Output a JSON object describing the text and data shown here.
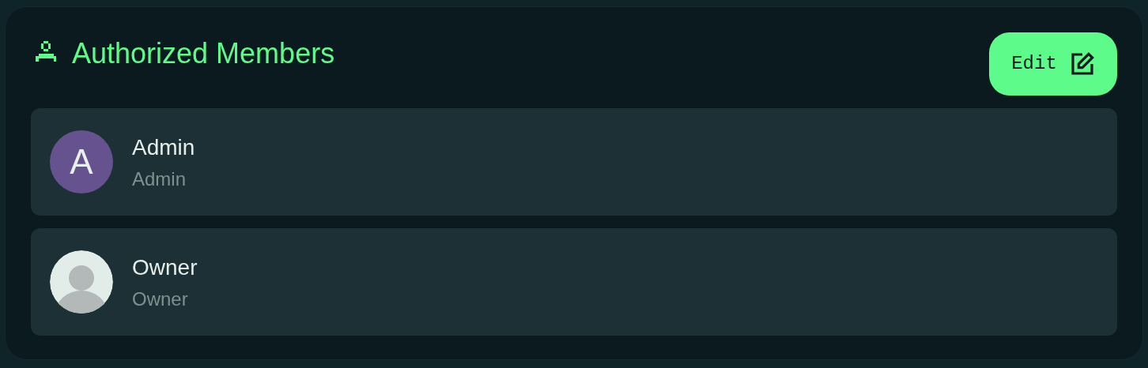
{
  "header": {
    "title": "Authorized Members",
    "edit_button": "Edit"
  },
  "members": [
    {
      "kind": "letter",
      "initial": "A",
      "color": "#66528f",
      "name": "Admin",
      "role": "Admin"
    },
    {
      "kind": "silhouette",
      "name": "Owner",
      "role": "Owner"
    }
  ]
}
